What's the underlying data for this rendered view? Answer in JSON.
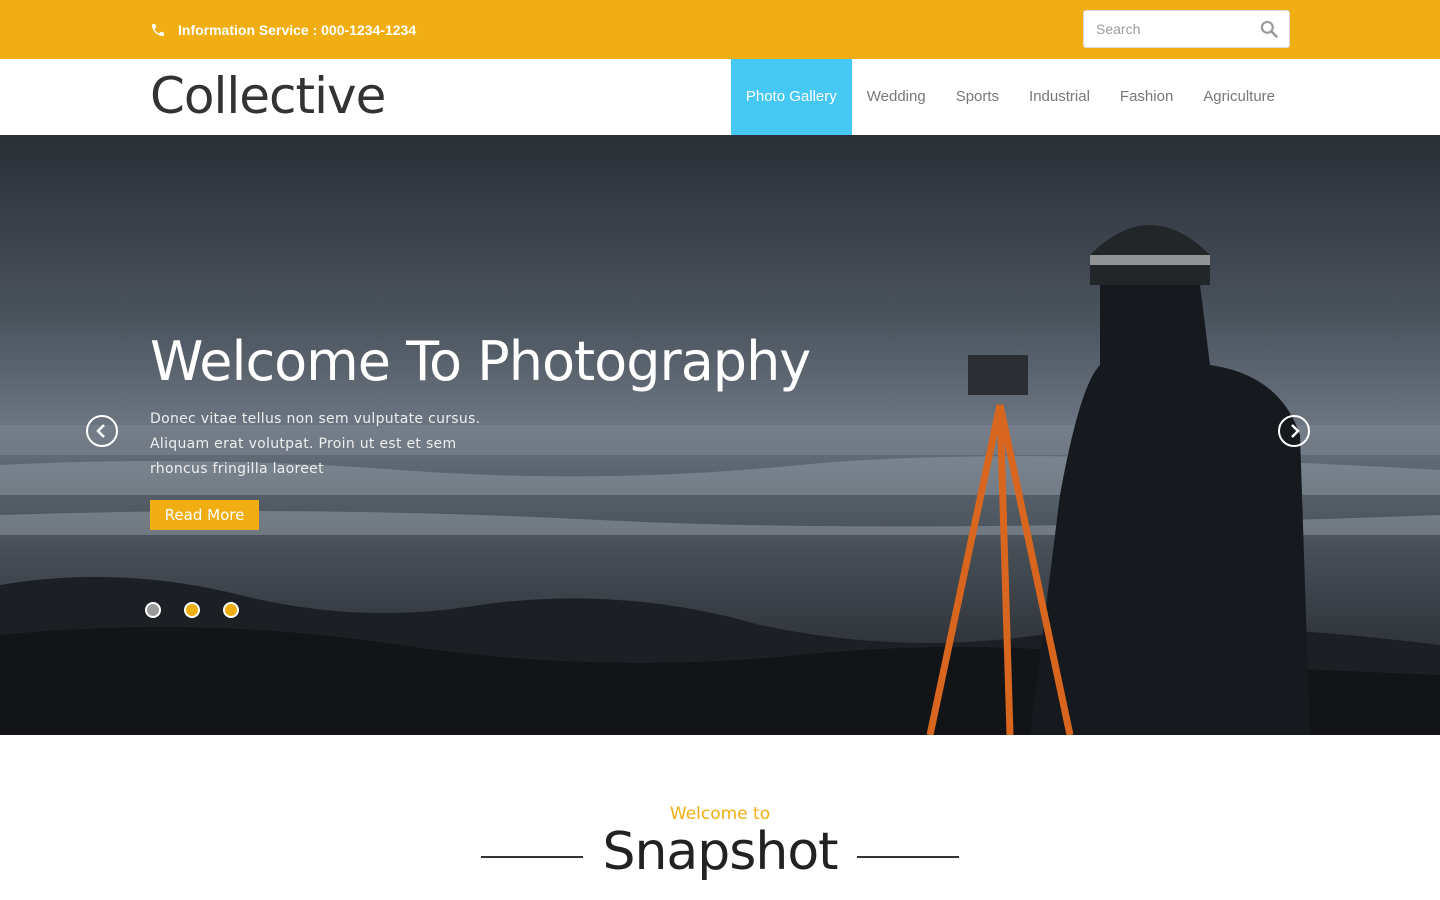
{
  "topbar": {
    "info_text": "Information Service : 000-1234-1234",
    "phone_icon": "phone-icon",
    "search_placeholder": "Search",
    "search_icon": "search-icon"
  },
  "header": {
    "logo": "Collective",
    "nav": [
      {
        "label": "Photo Gallery",
        "active": true
      },
      {
        "label": "Wedding",
        "active": false
      },
      {
        "label": "Sports",
        "active": false
      },
      {
        "label": "Industrial",
        "active": false
      },
      {
        "label": "Fashion",
        "active": false
      },
      {
        "label": "Agriculture",
        "active": false
      }
    ]
  },
  "hero": {
    "title": "Welcome To Photography",
    "text": "Donec vitae tellus non sem vulputate cursus. Aliquam erat volutpat. Proin ut est et sem rhoncus fringilla laoreet",
    "button_label": "Read More",
    "prev_icon": "chevron-left-icon",
    "next_icon": "chevron-right-icon",
    "slides": 3,
    "active_slide": 1
  },
  "welcome": {
    "small": "Welcome to",
    "big": "Snapshot"
  },
  "colors": {
    "accent": "#f1ae12",
    "nav_active": "#46c8f5",
    "text_dark": "#333333"
  }
}
